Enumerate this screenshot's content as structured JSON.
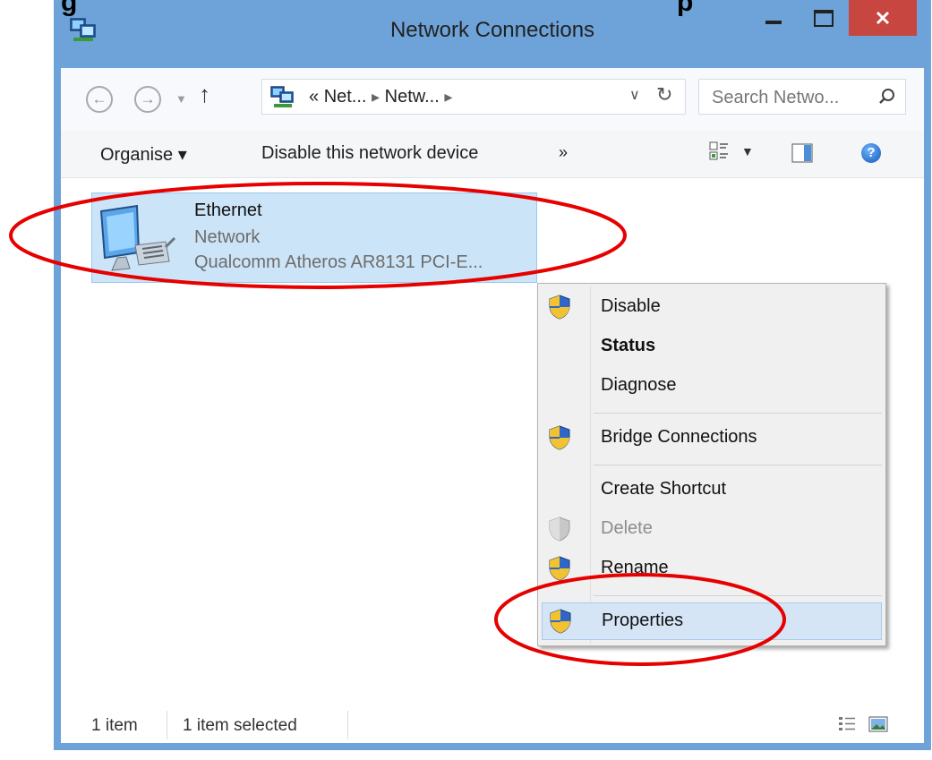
{
  "window": {
    "title": "Network Connections"
  },
  "address_bar": {
    "path": [
      "Net...",
      "Netw..."
    ],
    "path_prefix": "«",
    "separator": "▸",
    "search_placeholder": "Search Netwo..."
  },
  "command_bar": {
    "organise": "Organise ▾",
    "disable_device": "Disable this network device",
    "more": "»"
  },
  "file_item": {
    "name": "Ethernet",
    "type": "Network",
    "device": "Qualcomm Atheros AR8131 PCI-E..."
  },
  "context_menu": {
    "disable": "Disable",
    "status": "Status",
    "diagnose": "Diagnose",
    "bridge": "Bridge Connections",
    "create_shortcut": "Create Shortcut",
    "delete": "Delete",
    "rename": "Rename",
    "properties": "Properties"
  },
  "status_bar": {
    "count": "1 item",
    "selected": "1 item selected"
  },
  "colors": {
    "titlebar": "#6ea3d9",
    "close_button": "#c7463f",
    "selection": "#cce4f7",
    "annotation": "#e60000"
  }
}
